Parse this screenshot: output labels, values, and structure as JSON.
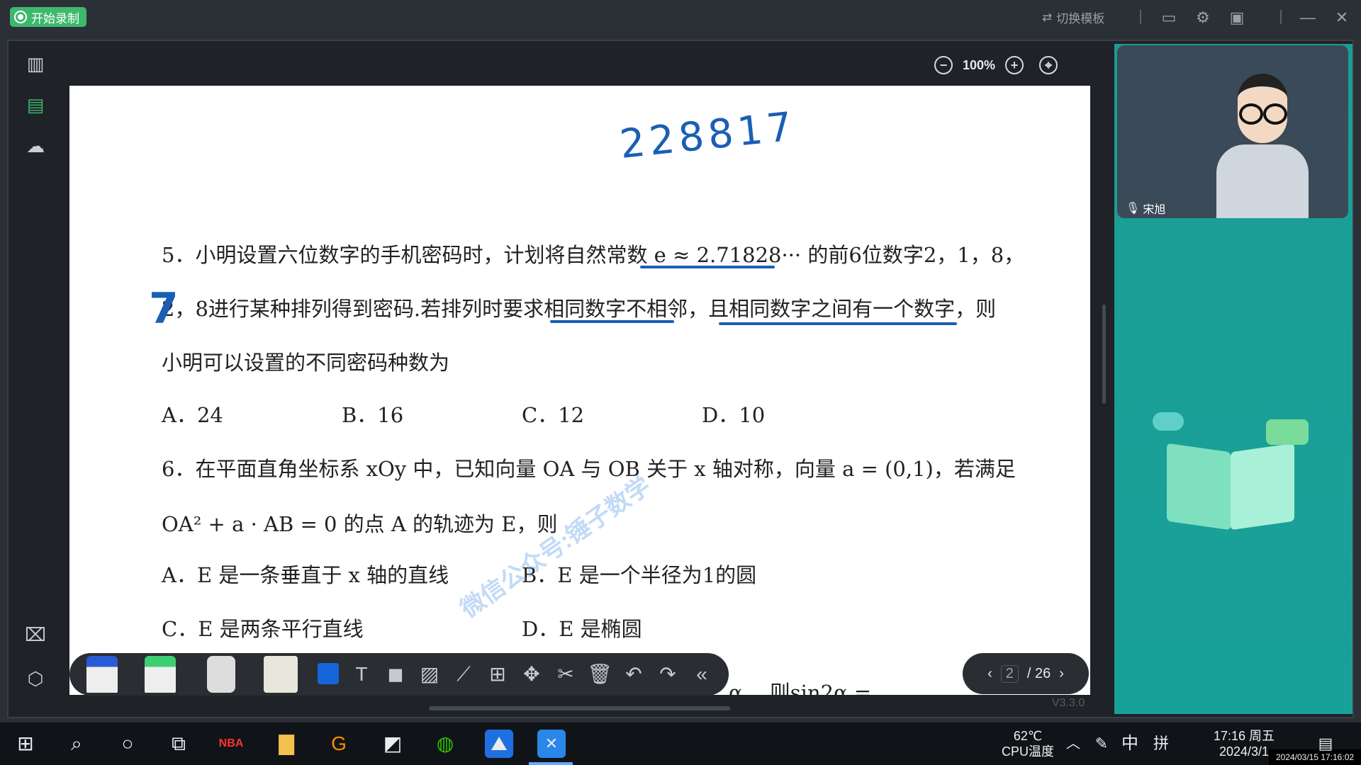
{
  "topbar": {
    "record_label": "开始录制",
    "switch_template_label": "切换模板"
  },
  "zoom": {
    "level": "100%"
  },
  "handwriting": {
    "top_number": "228817",
    "margin_digit": "7"
  },
  "question5": {
    "line1": "5．小明设置六位数字的手机密码时，计划将自然常数 e ≈ 2.71828··· 的前6位数字2，1，8，",
    "line2": "2，8进行某种排列得到密码.若排列时要求相同数字不相邻，且相同数字之间有一个数字，则",
    "line3": "小明可以设置的不同密码种数为",
    "options": [
      "A．24",
      "B．16",
      "C．12",
      "D．10"
    ]
  },
  "question6": {
    "line1": "6．在平面直角坐标系 xOy 中，已知向量 OA 与 OB 关于 x 轴对称，向量 a = (0,1)，若满足",
    "line2": "OA² + a · AB = 0 的点 A 的轨迹为 E，则",
    "options": [
      "A．E 是一条垂直于 x 轴的直线",
      "B．E 是一个半径为1的圆",
      "C．E 是两条平行直线",
      "D．E 是椭圆"
    ]
  },
  "partial_next": "α，  则sin2α =",
  "watermark": "微信公众号:锤子数学",
  "video": {
    "teacher_name": "宋旭"
  },
  "pager": {
    "current": "2",
    "total": "/ 26"
  },
  "version": "V3.3.0",
  "taskbar": {
    "temp": "62℃",
    "temp_label": "CPU温度",
    "ime": "中",
    "ime2": "拼",
    "time": "17:16 周五",
    "date": "2024/3/1",
    "stamp": "2024/03/15 17:16:02"
  },
  "colors": {
    "accent_green": "#3db86d",
    "panel_teal": "#1b9d94",
    "ink_blue": "#1a5fb4"
  }
}
